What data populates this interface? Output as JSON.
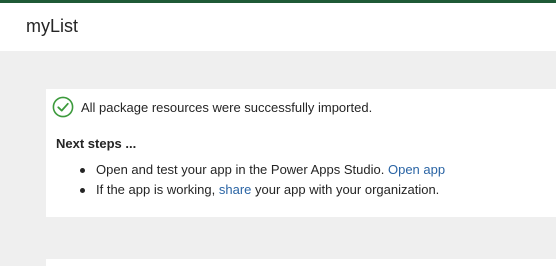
{
  "header": {
    "title": "myList"
  },
  "status": {
    "icon": "check-circle-icon",
    "success_color": "#3c9a3c",
    "message": "All package resources were successfully imported."
  },
  "next_steps": {
    "heading": "Next steps ...",
    "step1": {
      "text": "Open and test your app in the Power Apps Studio.",
      "link": "Open app"
    },
    "step2": {
      "before": "If the app is working,",
      "link": "share",
      "after": "your app with your organization."
    }
  },
  "colors": {
    "accent": "#1f5a36",
    "link": "#2a64a4",
    "background": "#efefef"
  }
}
